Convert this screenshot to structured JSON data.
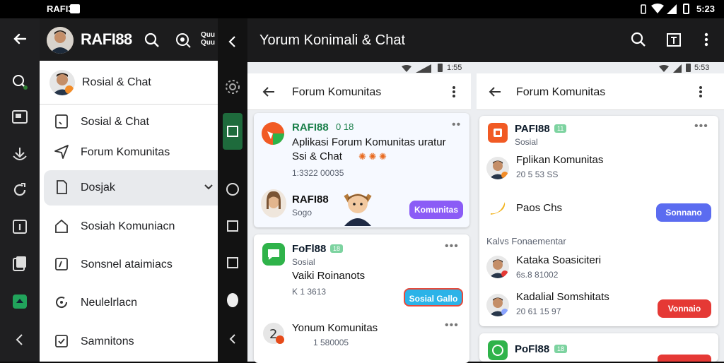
{
  "status_bar": {
    "left_label": "RAFI3",
    "time": "5:23"
  },
  "drawer": {
    "app_name": "RAFI88",
    "profile_name": "Rosial & Chat",
    "items": [
      {
        "label": "Sosial & Chat",
        "icon": "note-icon"
      },
      {
        "label": "Forum Komunitas",
        "icon": "send-icon"
      },
      {
        "label": "Dosjak",
        "icon": "document-icon",
        "selected": true
      },
      {
        "label": "Sosiah Komuniacn",
        "icon": "home-icon"
      },
      {
        "label": "Sonsnel ataimiacs",
        "icon": "edit-box-icon"
      },
      {
        "label": "Neulelrlacn",
        "icon": "refresh-icon"
      },
      {
        "label": "Samnitons",
        "icon": "check-box-icon"
      }
    ],
    "header_text_fragment": "Quu\nQuu"
  },
  "app_bar": {
    "title": "Yorum Konimali & Chat"
  },
  "pane_left": {
    "status_time": "1:55",
    "title": "Forum Komunitas",
    "posts": [
      {
        "name": "RAFI88",
        "tag": "0 18",
        "body": "Aplikasi Forum Komunitas uratur Ssi & Chat",
        "meta": "1:3322 00035",
        "author": "RAFI88",
        "author_sub": "Sogo",
        "button": "Komunitas",
        "button_color": "#8b5cf6"
      },
      {
        "name": "FoFl88",
        "badge": "18",
        "sub": "Sosial",
        "body": "Vaiki Roinanots",
        "meta": "K  1 3613",
        "button": "Sosial Gallo",
        "button_color": "#2bb3e8"
      },
      {
        "name": "Yonum Komunitas",
        "meta": "1 580005"
      }
    ]
  },
  "pane_right": {
    "status_time": "5:53",
    "title": "Forum Komunitas",
    "card1": {
      "name": "PAFI88",
      "badge": "11",
      "sub": "Sosial",
      "rows": [
        {
          "title": "Fplikan Komunitas",
          "meta": "20 5  53 SS"
        },
        {
          "title": "Paos Chs",
          "meta": ""
        }
      ],
      "button": "Sonnano",
      "button_color": "#5b6cf0",
      "section": "Kalvs  Fonaementar",
      "rows2": [
        {
          "title": "Kataka Soasiciteri",
          "meta": "6s.8  81002"
        },
        {
          "title": "Kadalial Somshitats",
          "meta": "20 61  15 97"
        }
      ],
      "button2": "Vonnaio",
      "button2_color": "#e53935"
    },
    "card2": {
      "name": "PoFl88",
      "badge": "18"
    }
  }
}
